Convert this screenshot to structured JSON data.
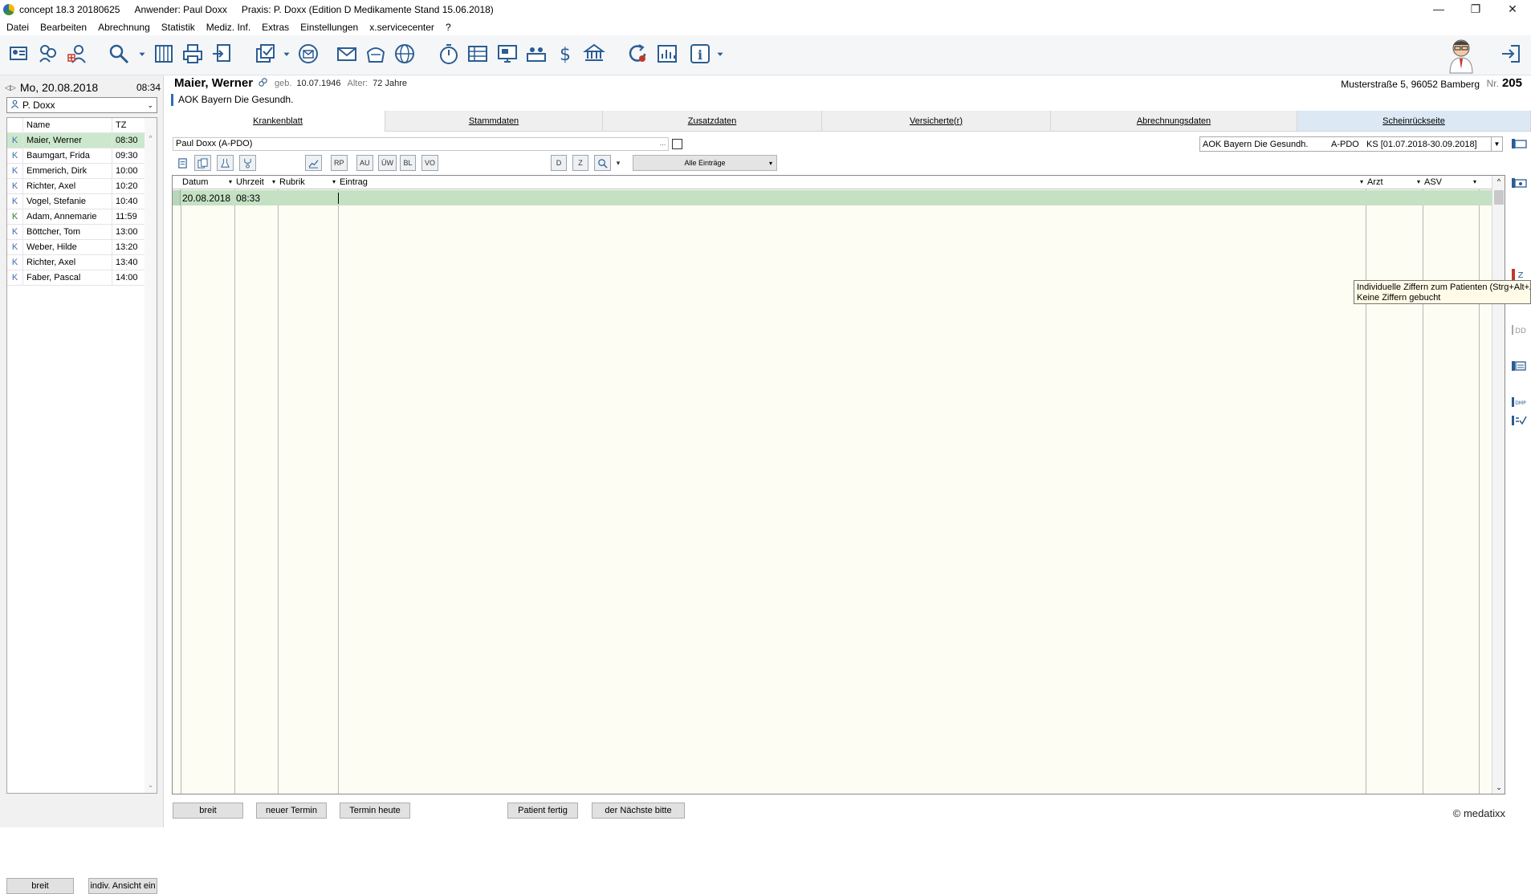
{
  "window": {
    "app": "concept 18.3 20180625",
    "user": "Anwender:  Paul Doxx",
    "practice": "Praxis: P. Doxx  (Edition D Medikamente  Stand 15.06.2018)",
    "minimize": "—",
    "restore": "❐",
    "close": "✕"
  },
  "menu": [
    "Datei",
    "Bearbeiten",
    "Abrechnung",
    "Statistik",
    "Mediz. Inf.",
    "Extras",
    "Einstellungen",
    "x.servicecenter",
    "?"
  ],
  "toolbar_icons": [
    "patient-card-icon",
    "patients-icon",
    "new-patient-icon",
    "search-icon",
    "dropdown-icon",
    "calendar-book-icon",
    "print-icon",
    "document-export-icon",
    "document-stack-icon",
    "dropdown-icon",
    "mail-circle-icon",
    "envelope-icon",
    "mail-bag-icon",
    "globe-icon",
    "stopwatch-icon",
    "list-grid-icon",
    "monitor-icon",
    "waiting-room-icon",
    "dollar-icon",
    "bank-icon",
    "refresh-icon",
    "chart-icon",
    "info-icon",
    "dropdown-icon",
    "assistant-avatar-icon",
    "logout-icon"
  ],
  "left": {
    "date": "Mo, 20.08.2018",
    "time": "08:34",
    "doctor": "P. Doxx",
    "table_headers": {
      "name": "Name",
      "tz": "TZ"
    },
    "appointments": [
      {
        "k": "K",
        "name": "Maier, Werner",
        "time": "08:30",
        "selected": true
      },
      {
        "k": "K",
        "name": "Baumgart, Frida",
        "time": "09:30"
      },
      {
        "k": "K",
        "name": "Emmerich, Dirk",
        "time": "10:00"
      },
      {
        "k": "K",
        "name": "Richter, Axel",
        "time": "10:20"
      },
      {
        "k": "K",
        "name": "Vogel, Stefanie",
        "time": "10:40"
      },
      {
        "k": "K",
        "name": "Adam, Annemarie",
        "time": "11:59",
        "accent": "#2e7d32"
      },
      {
        "k": "K",
        "name": "Böttcher, Tom",
        "time": "13:00"
      },
      {
        "k": "K",
        "name": "Weber, Hilde",
        "time": "13:20"
      },
      {
        "k": "K",
        "name": "Richter, Axel",
        "time": "13:40"
      },
      {
        "k": "K",
        "name": "Faber, Pascal",
        "time": "14:00"
      }
    ],
    "btn_wide": "breit",
    "btn_indiv": "indiv. Ansicht ein"
  },
  "patient": {
    "name": "Maier, Werner",
    "born_label": "geb.",
    "born": "10.07.1946",
    "age_label": "Alter:",
    "age": "72 Jahre",
    "insurance": "AOK Bayern Die Gesundh.",
    "address": "Musterstraße 5, 96052 Bamberg",
    "nr_label": "Nr.",
    "nr": "205"
  },
  "tabs": [
    "Krankenblatt",
    "Stammdaten",
    "Zusatzdaten",
    "Versicherte(r)",
    "Abrechnungsdaten",
    "Scheinrückseite"
  ],
  "filter": {
    "user": "Paul Doxx (A-PDO)",
    "user_btn": "...",
    "ins_name": "AOK Bayern Die Gesundh.",
    "ins_code": "A-PDO",
    "ins_range": "KS  [01.07.2018-30.09.2018]"
  },
  "small_toolbar": {
    "rp": "RP",
    "au": "AU",
    "uw": "ÜW",
    "bl": "BL",
    "vo": "VO",
    "d": "D",
    "z": "Z",
    "filter": "Alle Einträge"
  },
  "grid": {
    "headers": {
      "datum": "Datum",
      "uhrzeit": "Uhrzeit",
      "rubrik": "Rubrik",
      "eintrag": "Eintrag",
      "arzt": "Arzt",
      "asv": "ASV"
    },
    "row": {
      "datum": "20.08.2018",
      "uhrzeit": "08:33"
    }
  },
  "right_icons": [
    "card-icon",
    "camera-card-icon",
    "fee-codes-icon",
    "dd-icon",
    "list-card-icon",
    "dmp-icon",
    "check-list-icon"
  ],
  "tooltip": {
    "line1": "Individuelle Ziffern zum Patienten (Strg+Alt+Z):",
    "line2": "Keine Ziffern gebucht"
  },
  "bottom": {
    "breit": "breit",
    "neuer_termin": "neuer Termin",
    "termin_heute": "Termin heute",
    "patient_fertig": "Patient fertig",
    "naechste": "der Nächste bitte"
  },
  "copyright": "© medatixx"
}
